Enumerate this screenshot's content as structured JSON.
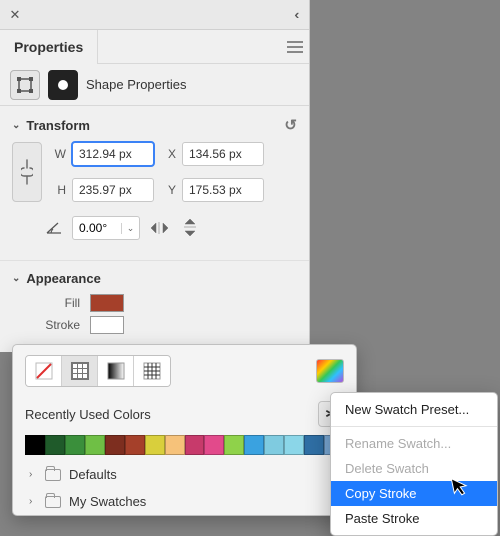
{
  "panel": {
    "title": "Properties",
    "subheader": "Shape Properties"
  },
  "transform": {
    "heading": "Transform",
    "w_label": "W",
    "w_value": "312.94 px",
    "h_label": "H",
    "h_value": "235.97 px",
    "x_label": "X",
    "x_value": "134.56 px",
    "y_label": "Y",
    "y_value": "175.53 px",
    "angle": "0.00°"
  },
  "appearance": {
    "heading": "Appearance",
    "fill_label": "Fill",
    "fill_color": "#a5402a",
    "stroke_label": "Stroke",
    "stroke_color": "#f6c27a"
  },
  "popup": {
    "recent_label": "Recently Used Colors",
    "recent_colors": [
      "#000000",
      "#1f5a2a",
      "#3a8f3b",
      "#6fbf45",
      "#7d2e1f",
      "#a5402a",
      "#d9cf3c",
      "#f6c27a",
      "#c73a6b",
      "#e24a8b",
      "#8fd24a",
      "#3aa2e0",
      "#7fcbe0",
      "#8bd6e8",
      "#2f6fa5",
      "#7aa9d6"
    ],
    "folders": [
      "Defaults",
      "My Swatches"
    ]
  },
  "context_menu": {
    "items": [
      {
        "label": "New Swatch Preset...",
        "state": "normal"
      },
      {
        "label": "Rename Swatch...",
        "state": "disabled"
      },
      {
        "label": "Delete Swatch",
        "state": "disabled"
      },
      {
        "label": "Copy Stroke",
        "state": "highlight"
      },
      {
        "label": "Paste Stroke",
        "state": "normal"
      }
    ]
  }
}
